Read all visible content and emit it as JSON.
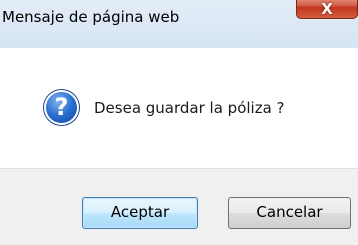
{
  "dialog": {
    "title": "Mensaje de página web",
    "close_label": "X",
    "icon": "question-icon",
    "icon_glyph": "?",
    "message": "Desea guardar la póliza ?",
    "buttons": {
      "accept_label": "Aceptar",
      "cancel_label": "Cancelar"
    }
  },
  "colors": {
    "titlebar": "#d9e6f4",
    "close_button": "#c84a30",
    "icon_blue": "#1f5fc4",
    "footer": "#f0f0f0"
  }
}
